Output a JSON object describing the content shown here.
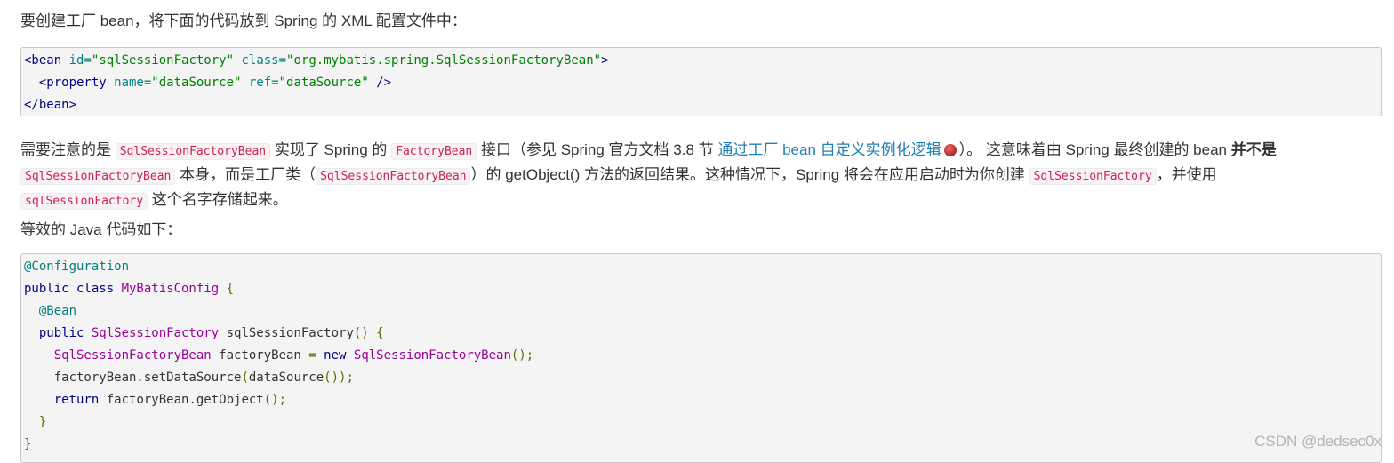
{
  "intro": {
    "text_before": "要创建工厂 bean，将下面的代码放到 Spring 的 XML 配置文件中："
  },
  "xml": {
    "l1_open": "<bean",
    "l1_attr1": " id=",
    "l1_val1": "\"sqlSessionFactory\"",
    "l1_attr2": " class=",
    "l1_val2": "\"org.mybatis.spring.SqlSessionFactoryBean\"",
    "l1_close": ">",
    "l2_indent": "  ",
    "l2_open": "<property",
    "l2_attr1": " name=",
    "l2_val1": "\"dataSource\"",
    "l2_attr2": " ref=",
    "l2_val2": "\"dataSource\"",
    "l2_close": " />",
    "l3": "</bean>"
  },
  "note": {
    "t1": "需要注意的是 ",
    "c1": "SqlSessionFactoryBean",
    "t2": " 实现了 Spring 的 ",
    "c2": "FactoryBean",
    "t3": " 接口（参见 Spring 官方文档 3.8 节 ",
    "link": "通过工厂 bean 自定义实例化逻辑",
    "t4": "）。 这意味着由 Spring 最终创建的 bean ",
    "bold1": "并不是",
    "c3": "SqlSessionFactoryBean",
    "t5": " 本身，而是工厂类（",
    "c4": "SqlSessionFactoryBean",
    "t6": "）的 getObject() 方法的返回结果。这种情况下，Spring 将会在应用启动时为你创建 ",
    "c5": "SqlSessionFactory",
    "t7": "，并使用",
    "c6": "sqlSessionFactory",
    "t8": " 这个名字存储起来。"
  },
  "equiv": {
    "text": "等效的 Java 代码如下："
  },
  "java": {
    "l1": "@Configuration",
    "l2_kw": "public class ",
    "l2_type": "MyBatisConfig",
    "l2_punc": " {",
    "l3": "  @Bean",
    "l4_kw": "  public ",
    "l4_type": "SqlSessionFactory",
    "l4_name": " sqlSessionFactory",
    "l4_punc": "() {",
    "l5_type": "    SqlSessionFactoryBean",
    "l5_name": " factoryBean ",
    "l5_eq": "=",
    "l5_kw": " new ",
    "l5_type2": "SqlSessionFactoryBean",
    "l5_punc": "();",
    "l6_a": "    factoryBean.setDataSource",
    "l6_b": "(",
    "l6_c": "dataSource",
    "l6_d": "());",
    "l7_kw": "    return",
    "l7_name": " factoryBean.getObject",
    "l7_punc": "();",
    "l8": "  }",
    "l9": "}"
  },
  "watermark": "CSDN @dedsec0x",
  "colors": {
    "inline_code": "#c7254e",
    "link": "#1f7fb4",
    "code_bg": "#f4f4f4"
  }
}
